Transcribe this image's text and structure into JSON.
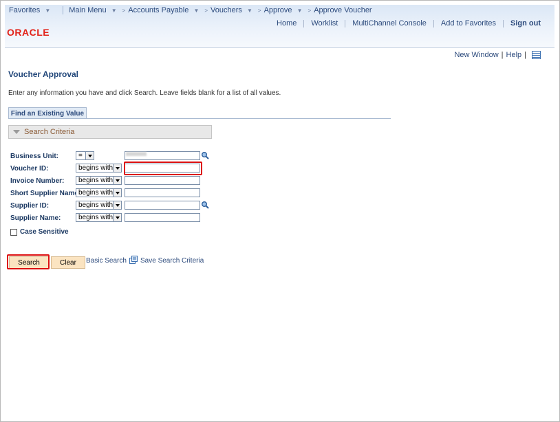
{
  "menubar": {
    "favorites": "Favorites",
    "main_menu": "Main Menu",
    "breadcrumbs": [
      "Accounts Payable",
      "Vouchers",
      "Approve",
      "Approve Voucher"
    ]
  },
  "brand": {
    "logo_text": "ORACLE",
    "logo_color": "#e2231a"
  },
  "toplinks": {
    "home": "Home",
    "worklist": "Worklist",
    "multichannel": "MultiChannel Console",
    "add_favorites": "Add to Favorites",
    "sign_out": "Sign out"
  },
  "util": {
    "new_window": "New Window",
    "help": "Help",
    "separator": "|"
  },
  "page": {
    "title": "Voucher Approval",
    "instructions": "Enter any information you have and click Search. Leave fields blank for a list of all values.",
    "tab": "Find an Existing Value",
    "criteria_header": "Search Criteria"
  },
  "fields": [
    {
      "label": "Business Unit:",
      "operator": "=",
      "value": ""
    },
    {
      "label": "Voucher ID:",
      "operator": "begins with",
      "value": ""
    },
    {
      "label": "Invoice Number:",
      "operator": "begins with",
      "value": ""
    },
    {
      "label": "Short Supplier Name:",
      "operator": "begins with",
      "value": ""
    },
    {
      "label": "Supplier ID:",
      "operator": "begins with",
      "value": ""
    },
    {
      "label": "Supplier Name:",
      "operator": "begins with",
      "value": ""
    }
  ],
  "case_sensitive": {
    "label": "Case Sensitive",
    "checked": false
  },
  "actions": {
    "search": "Search",
    "clear": "Clear",
    "basic_search": "Basic Search",
    "save_criteria": "Save Search Criteria"
  },
  "colors": {
    "highlight": "#dd1111",
    "link": "#2c4a7c",
    "button": "#fbe4c1"
  }
}
